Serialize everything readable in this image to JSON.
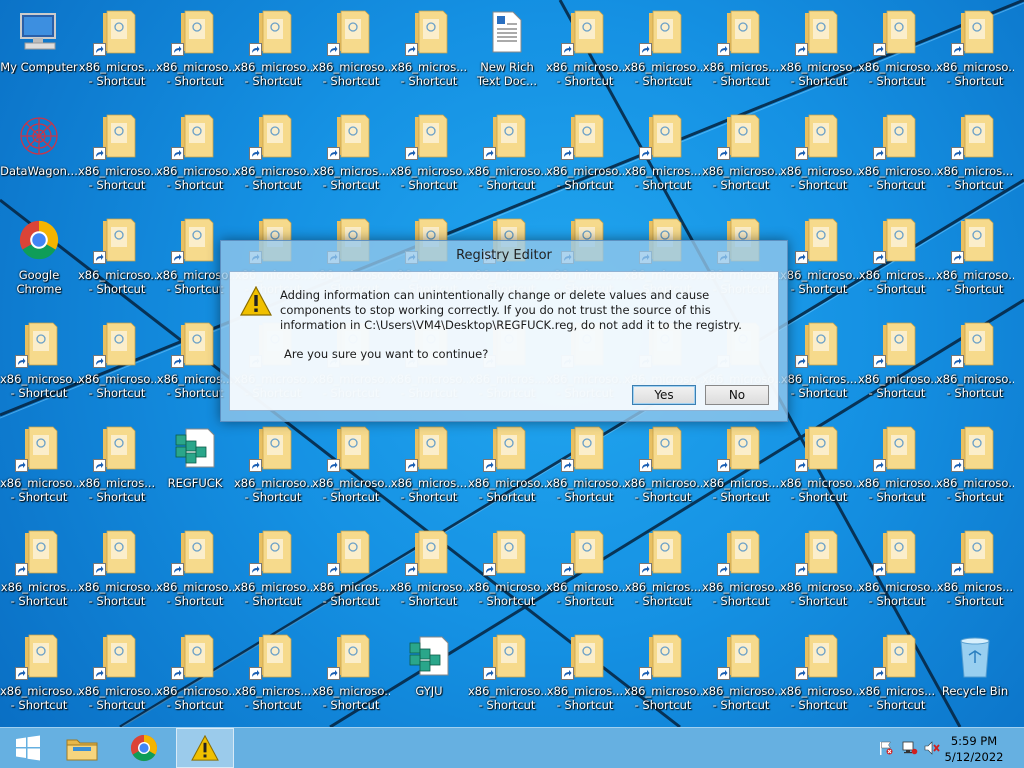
{
  "desktop": {
    "special_icons": [
      {
        "id": "my-computer",
        "label": "My Computer",
        "col": 0,
        "row": 0,
        "kind": "computer"
      },
      {
        "id": "datawagon",
        "label": "DataWagon...",
        "col": 0,
        "row": 1,
        "kind": "datawagon"
      },
      {
        "id": "google-chrome",
        "label": "Google\nChrome",
        "col": 0,
        "row": 2,
        "kind": "chrome"
      },
      {
        "id": "new-rich-text",
        "label": "New Rich\nText Doc...",
        "col": 6,
        "row": 0,
        "kind": "doc"
      },
      {
        "id": "regfuck",
        "label": "REGFUCK",
        "col": 2,
        "row": 4,
        "kind": "reg"
      },
      {
        "id": "gyju",
        "label": "GYJU",
        "col": 5,
        "row": 6,
        "kind": "reg"
      },
      {
        "id": "recycle-bin",
        "label": "Recycle Bin",
        "col": 12,
        "row": 6,
        "kind": "bin"
      }
    ],
    "shortcut_label_a": "x86_microso...\n- Shortcut",
    "shortcut_label_b": "x86_micros...\n- Shortcut"
  },
  "dialog": {
    "title": "Registry Editor",
    "message": "Adding information can unintentionally change or delete values and cause components to stop working correctly. If you do not trust the source of this information in C:\\Users\\VM4\\Desktop\\REGFUCK.reg, do not add it to the registry.",
    "question": "Are you sure you want to continue?",
    "yes_label": "Yes",
    "no_label": "No"
  },
  "taskbar": {
    "items": [
      "start-button",
      "file-explorer",
      "google-chrome",
      "registry-warning"
    ],
    "clock_time": "5:59 PM",
    "clock_date": "5/12/2022"
  },
  "colors": {
    "desktop": "#1591e3",
    "folder": "#f4d27a",
    "taskbar": "#6eb4e1"
  }
}
